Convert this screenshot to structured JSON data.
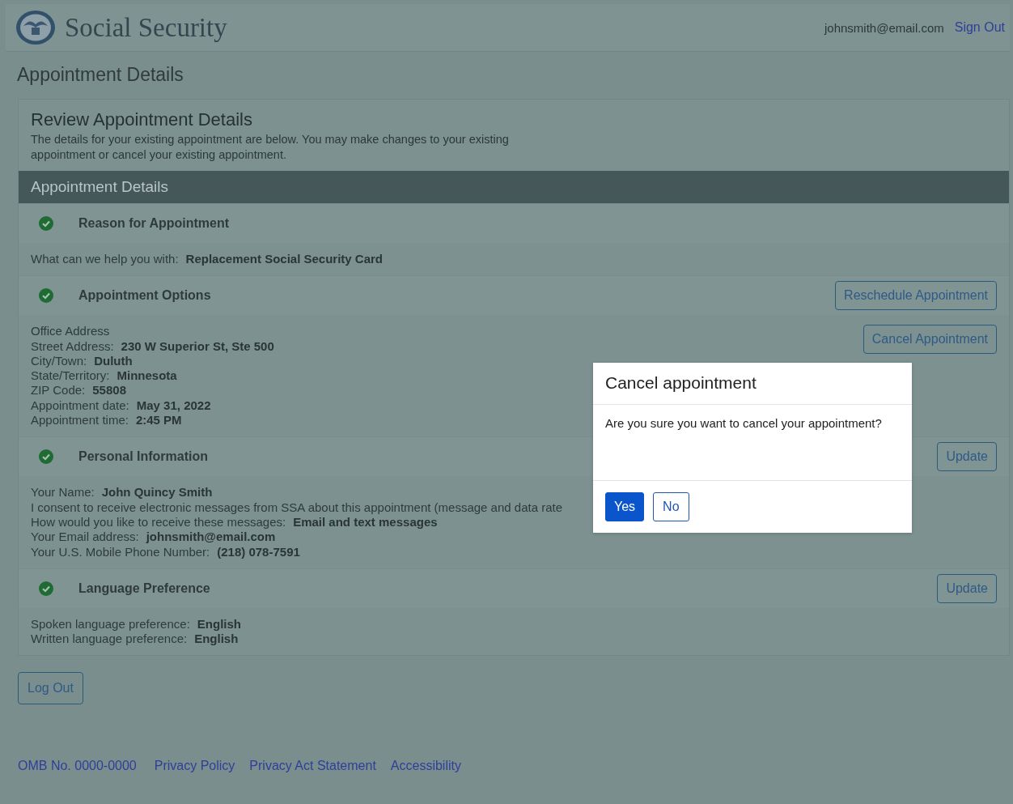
{
  "header": {
    "site_title": "Social Security",
    "user_email": "johnsmith@email.com",
    "sign_out": "Sign Out"
  },
  "page_title": "Appointment Details",
  "review": {
    "heading": "Review Appointment Details",
    "description": "The details for your existing appointment are below. You may make changes to your existing appointment or cancel your existing appointment."
  },
  "details_bar": "Appointment Details",
  "sections": [
    {
      "title": "Reason for Appointment",
      "completed": true,
      "lines": [
        {
          "label": "What can we help you with:",
          "value": "Replacement Social Security Card"
        }
      ]
    },
    {
      "title": "Appointment Options",
      "completed": true,
      "header_buttons": [
        "Reschedule Appointment"
      ],
      "body_buttons": [
        "Cancel Appointment"
      ],
      "lines": [
        {
          "label": "Office Address"
        },
        {
          "label": "Street Address:",
          "value": "230 W Superior St, Ste 500"
        },
        {
          "label": "City/Town:",
          "value": "Duluth"
        },
        {
          "label": "State/Territory:",
          "value": "Minnesota"
        },
        {
          "label": "ZIP Code:",
          "value": "55808"
        },
        {
          "label": "Appointment date:",
          "value": "May 31, 2022"
        },
        {
          "label": "Appointment time:",
          "value": "2:45 PM"
        }
      ]
    },
    {
      "title": "Personal Information",
      "completed": true,
      "header_buttons": [
        "Update"
      ],
      "lines": [
        {
          "label": "Your Name:",
          "value": "John Quincy Smith"
        },
        {
          "label": "I consent to receive electronic messages from SSA about this appointment (message and data rate"
        },
        {
          "label": "How would you like to receive these messages:",
          "value": "Email and text messages"
        },
        {
          "label": "Your Email address:",
          "value": "johnsmith@email.com"
        },
        {
          "label": "Your U.S. Mobile Phone Number:",
          "value": "(218) 078-7591"
        }
      ]
    },
    {
      "title": "Language Preference",
      "completed": true,
      "header_buttons": [
        "Update"
      ],
      "lines": [
        {
          "label": "Spoken language preference:",
          "value": "English"
        },
        {
          "label": "Written language preference:",
          "value": "English"
        }
      ]
    }
  ],
  "logout": "Log Out",
  "footer_links": [
    "OMB No. 0000-0000",
    "Privacy Policy",
    "Privacy Act Statement",
    "Accessibility"
  ],
  "modal": {
    "title": "Cancel appointment",
    "message": "Are you sure you want to cancel your appointment?",
    "buttons": [
      {
        "label": "Yes",
        "kind": "primary"
      },
      {
        "label": "No",
        "kind": "secondary"
      }
    ]
  }
}
